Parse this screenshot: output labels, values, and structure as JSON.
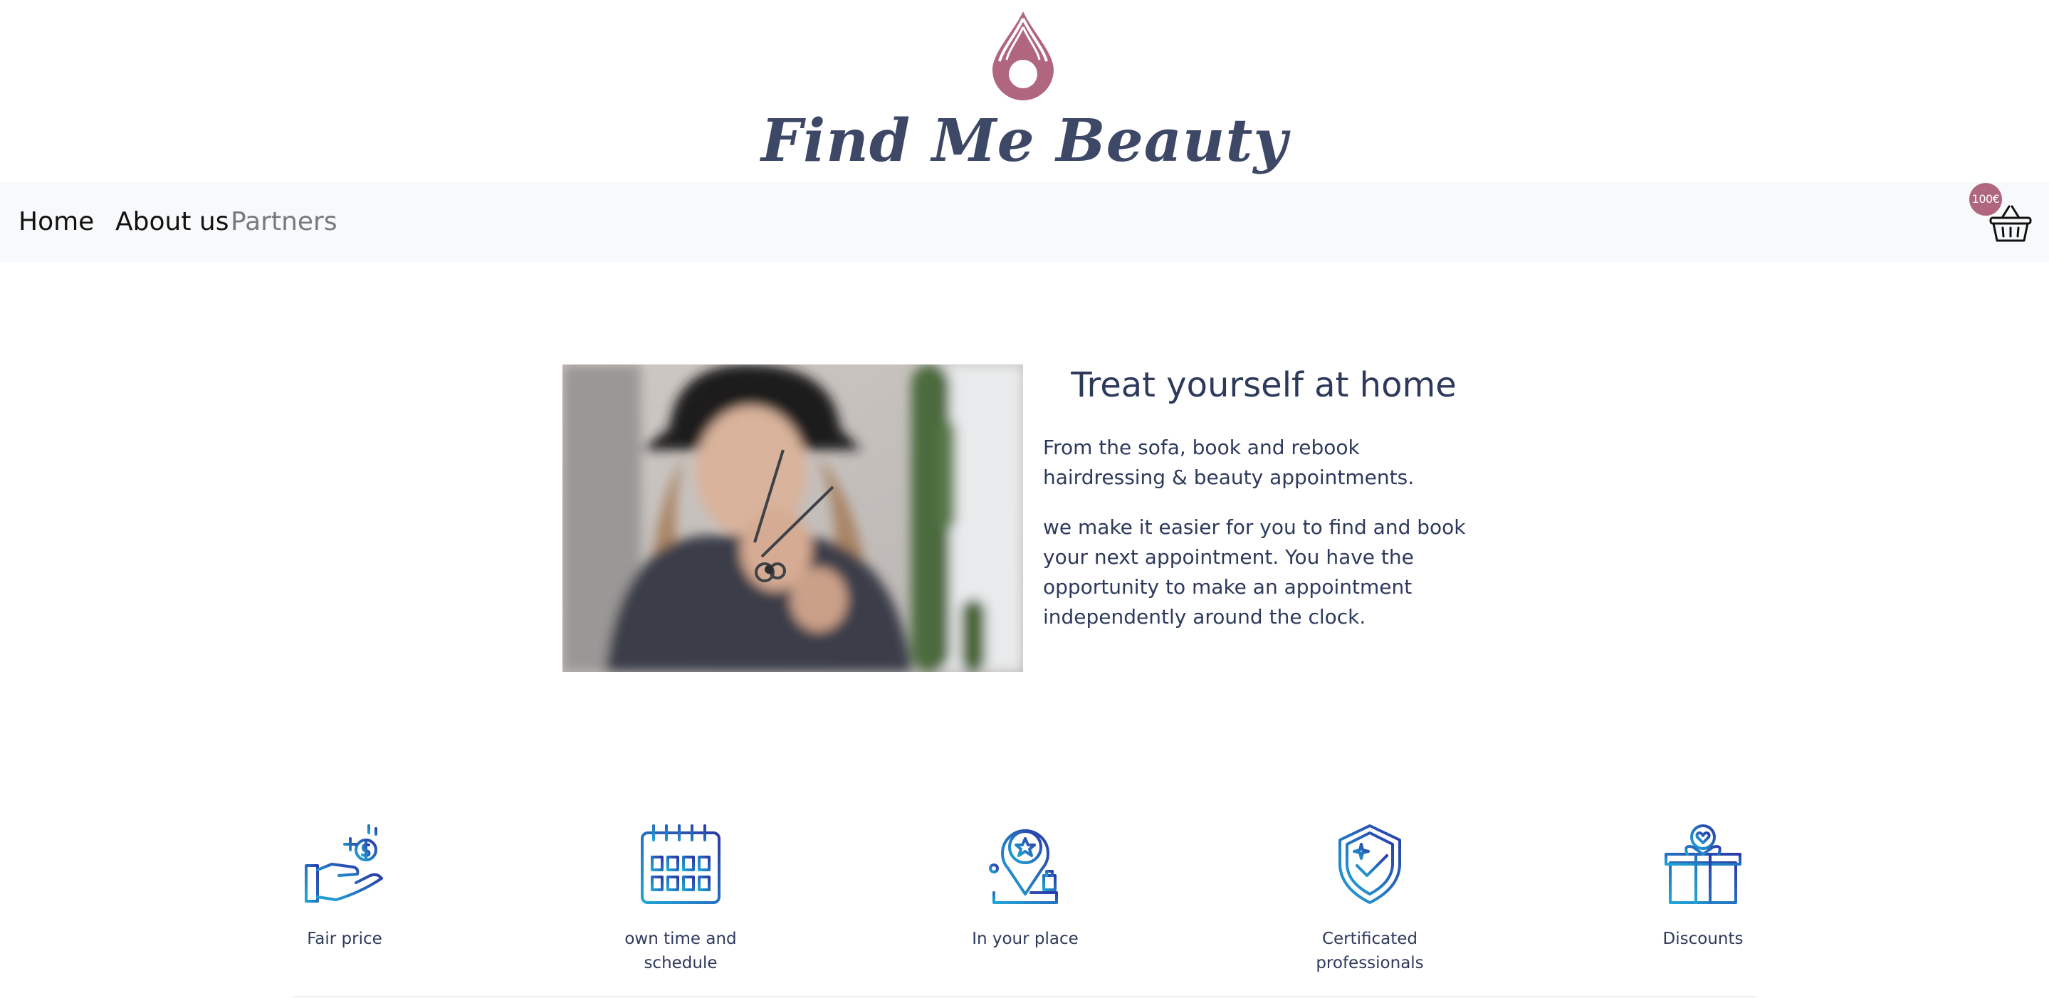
{
  "brand": {
    "name": "Find Me Beauty",
    "logo_icon": "droplet-logo-icon",
    "accent_color": "#b0667f",
    "text_color": "#3d4766"
  },
  "nav": {
    "items": [
      {
        "label": "Home",
        "active": false
      },
      {
        "label": "About us",
        "active": false
      },
      {
        "label": "Partners",
        "active": true
      }
    ]
  },
  "cart": {
    "total": "100€",
    "icon": "basket-icon"
  },
  "hero": {
    "image": "hairdresser-with-scissors-photo",
    "title": "Treat yourself at home",
    "paragraphs": [
      "From the sofa, book and rebook hairdressing & beauty appointments.",
      "we make it easier for you to find and book your next appointment. You have the opportunity to make an appointment independently around the clock."
    ]
  },
  "features": [
    {
      "label": "Fair price",
      "icon": "hand-coin-icon"
    },
    {
      "label": "own time and schedule",
      "icon": "calendar-icon"
    },
    {
      "label": "In your place",
      "icon": "location-pin-star-icon"
    },
    {
      "label": "Certificated professionals",
      "icon": "shield-check-icon"
    },
    {
      "label": "Discounts",
      "icon": "gift-heart-icon"
    }
  ]
}
